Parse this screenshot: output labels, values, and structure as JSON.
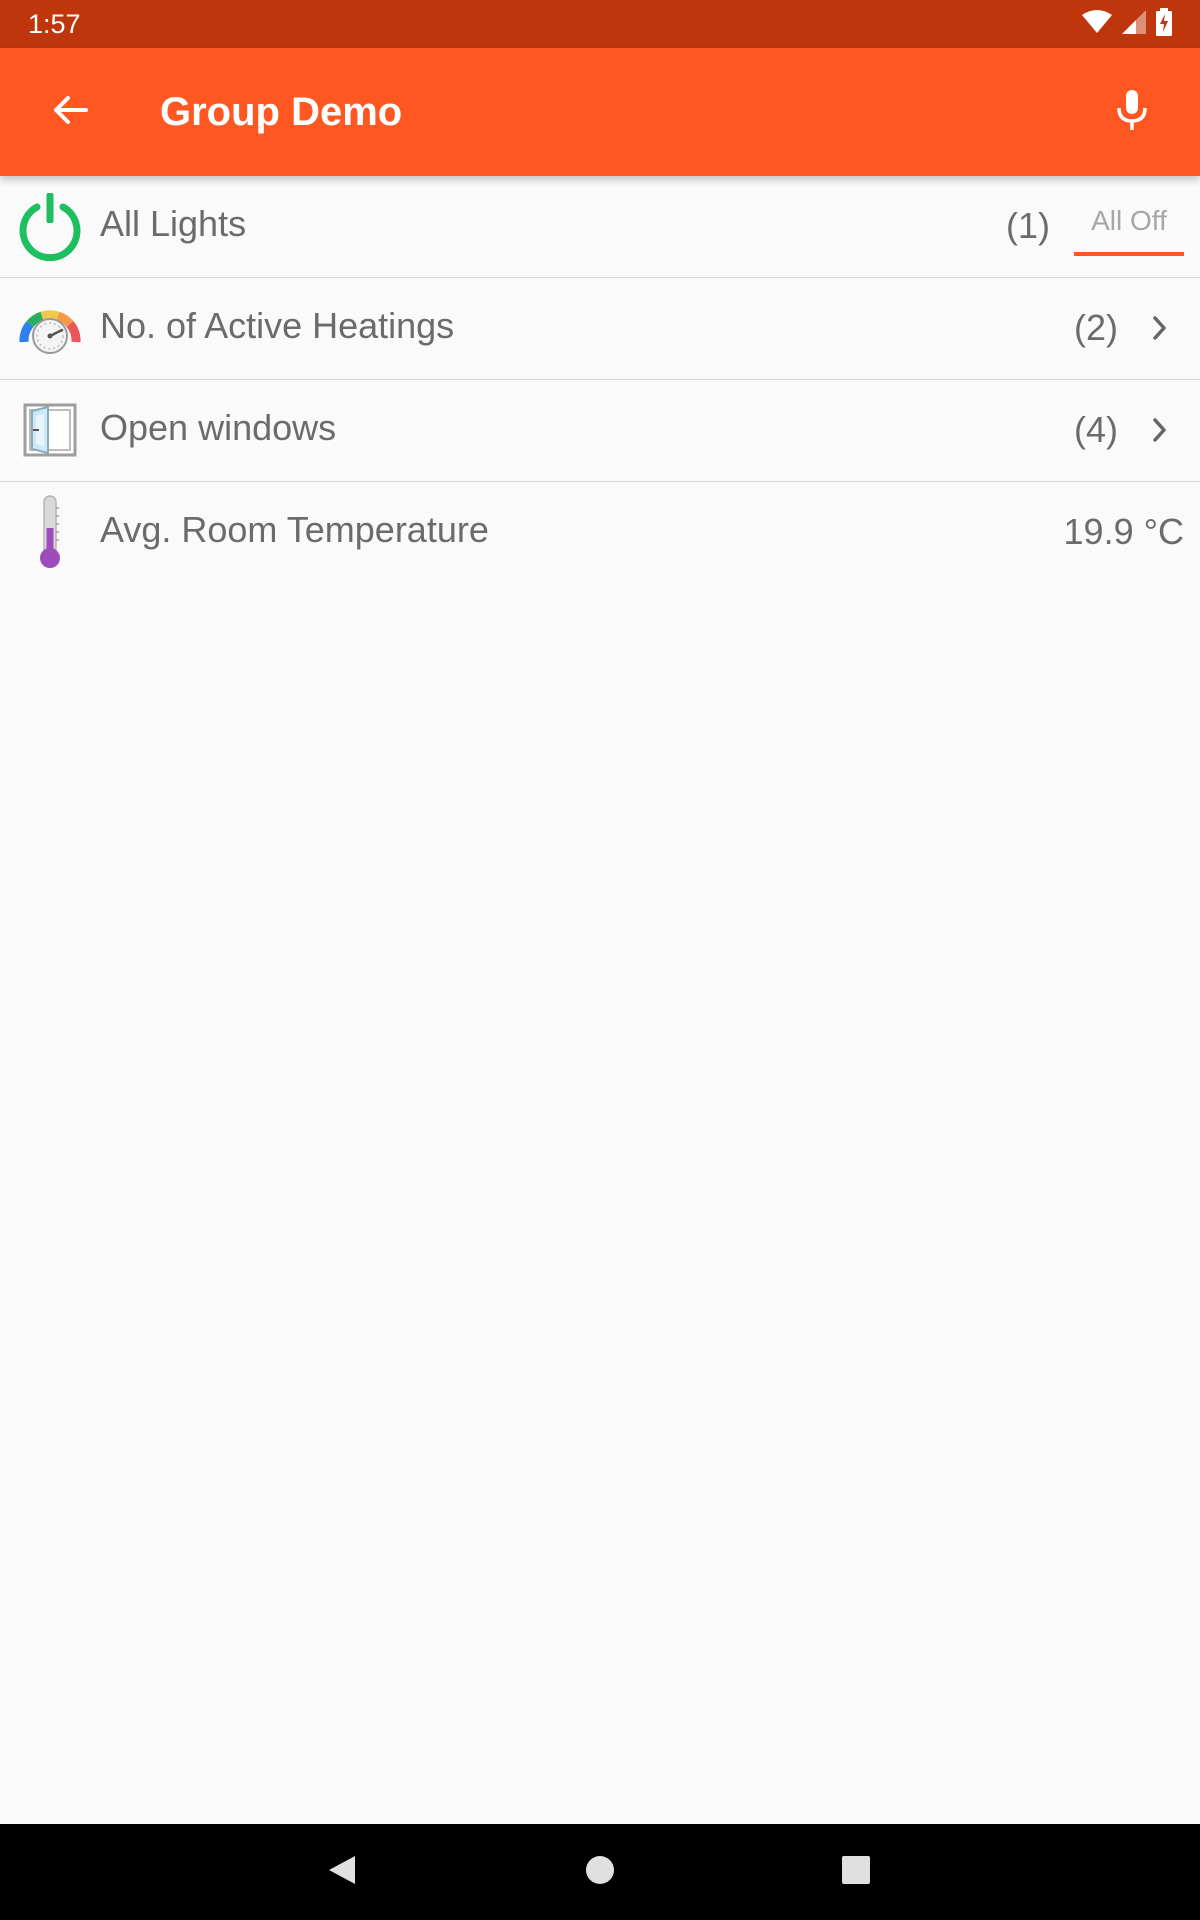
{
  "status_bar": {
    "time": "1:57",
    "icons": [
      "wifi-icon",
      "cell-signal-icon",
      "battery-charging-icon"
    ]
  },
  "app_bar": {
    "title": "Group Demo",
    "back_icon": "arrow-back-icon",
    "mic_icon": "mic-icon",
    "background": "#ff5722"
  },
  "items": [
    {
      "label": "All Lights",
      "count": "(1)",
      "action_label": "All Off",
      "icon": "power-icon",
      "icon_color": "#1dbf5f"
    },
    {
      "label": "No. of Active Heatings",
      "count": "(2)",
      "icon": "heating-gauge-icon"
    },
    {
      "label": "Open windows",
      "count": "(4)",
      "icon": "window-icon"
    },
    {
      "label": "Avg. Room Temperature",
      "value": "19.9 °C",
      "icon": "thermometer-icon",
      "icon_color": "#9c4dbb"
    }
  ],
  "nav_bar": {
    "icons": [
      "nav-back-icon",
      "nav-home-icon",
      "nav-recents-icon"
    ]
  },
  "colors": {
    "status_bar": "#bf360c",
    "accent": "#ff5722",
    "text": "#6b6b6b"
  }
}
